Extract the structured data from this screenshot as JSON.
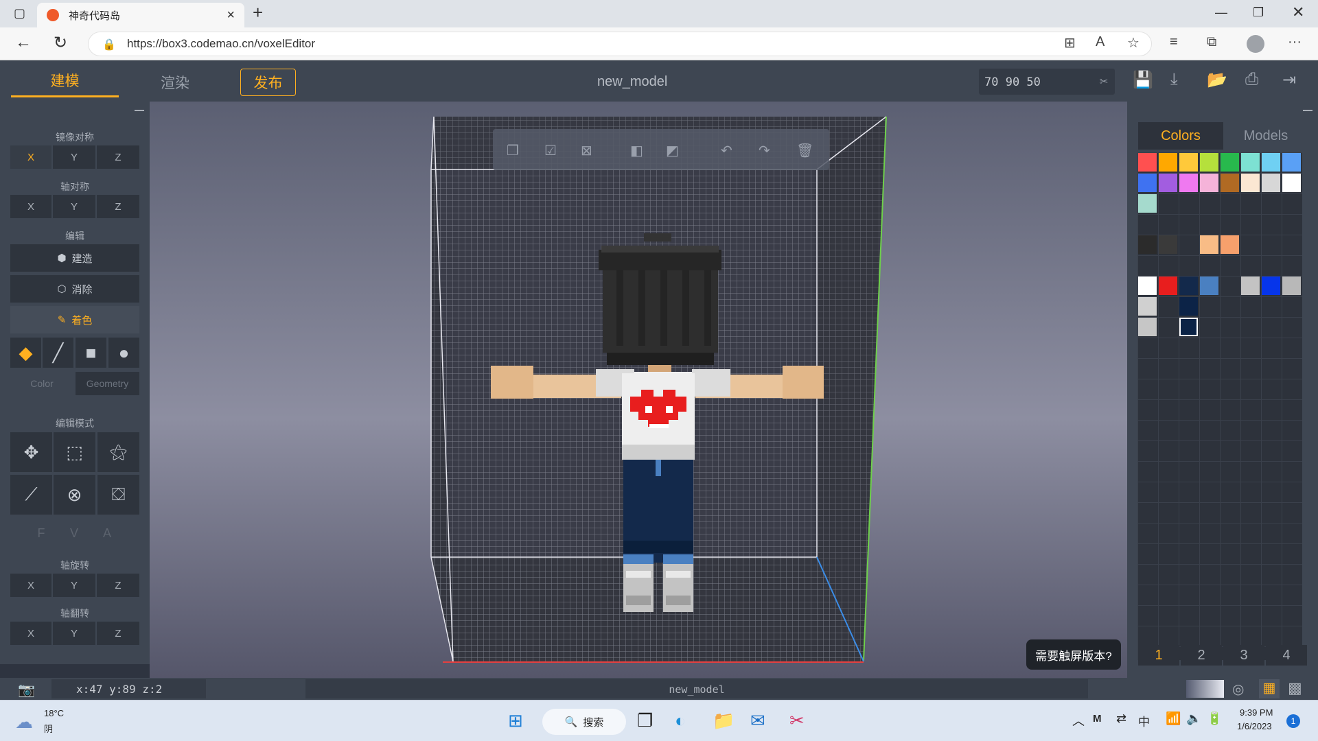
{
  "browser": {
    "tab_title": "神奇代码岛",
    "url": "https://box3.codemao.cn/voxelEditor"
  },
  "header": {
    "tabs": [
      "建模",
      "渲染",
      "发布"
    ],
    "doc_title": "new_model",
    "dimensions": "70  90  50"
  },
  "left": {
    "mirror_label": "镜像对称",
    "mirror_axes": [
      "X",
      "Y",
      "Z"
    ],
    "axis_sym_label": "轴对称",
    "axis_sym_axes": [
      "X",
      "Y",
      "Z"
    ],
    "edit_label": "编辑",
    "build": "建造",
    "erase": "消除",
    "paint": "着色",
    "mode_color": "Color",
    "mode_geometry": "Geometry",
    "edit_mode_label": "编辑模式",
    "fva": [
      "F",
      "V",
      "A"
    ],
    "rotate_label": "轴旋转",
    "rotate_axes": [
      "X",
      "Y",
      "Z"
    ],
    "flip_label": "轴翻转",
    "flip_axes": [
      "X",
      "Y",
      "Z"
    ]
  },
  "right": {
    "tabs": [
      "Colors",
      "Models"
    ],
    "pages": [
      "1",
      "2",
      "3",
      "4"
    ],
    "swatches": [
      "#ff5050",
      "#ffa800",
      "#ffc93a",
      "#b5e03c",
      "#28b94d",
      "#7de1d3",
      "#6fd0f3",
      "#5aa0f5",
      "#3f72f1",
      "#a25de0",
      "#ef79f0",
      "#f5b3d9",
      "#b06a23",
      "#fbe7d3",
      "#d7d7d7",
      "#ffffff",
      "#a5dacd",
      "#2b2b2b",
      "#3a3a3a",
      "#f8bc86",
      "#f6a06c",
      "#ffffff",
      "#e81e1e",
      "#13294b",
      "#4a80c1",
      "#c3c3c3",
      "#0635ea",
      "#b8b8b8",
      "#d0d0d0",
      "#0c2347",
      "#c6c6c6",
      "#0b2346"
    ]
  },
  "status": {
    "coords": "x:47  y:89  z:2",
    "model_name": "new_model"
  },
  "toast": "需要触屏版本?",
  "taskbar": {
    "temp": "18°C",
    "weather": "阴",
    "search": "搜索",
    "ime": "中",
    "time": "9:39 PM",
    "date": "1/6/2023",
    "badge": "1"
  }
}
